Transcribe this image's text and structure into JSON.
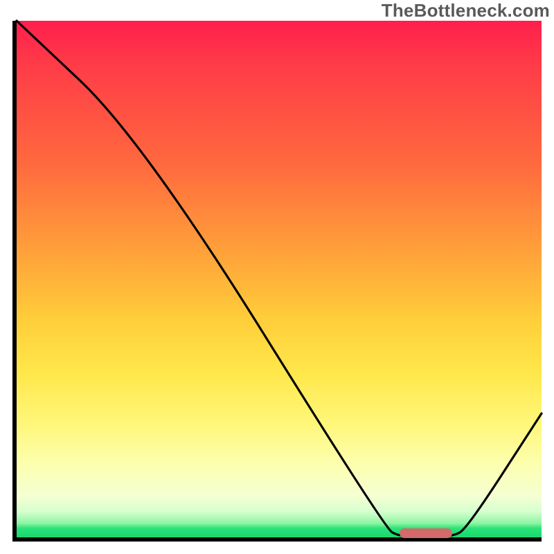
{
  "watermark": {
    "text": "TheBottleneck.com"
  },
  "chart_data": {
    "type": "line",
    "title": "",
    "xlabel": "",
    "ylabel": "",
    "xlim": [
      0,
      100
    ],
    "ylim": [
      0,
      100
    ],
    "grid": false,
    "legend": false,
    "curve_points_pct": [
      {
        "x": 0.0,
        "y": 100.0
      },
      {
        "x": 24.0,
        "y": 77.0
      },
      {
        "x": 70.0,
        "y": 2.0
      },
      {
        "x": 73.0,
        "y": 0.0
      },
      {
        "x": 83.0,
        "y": 0.0
      },
      {
        "x": 86.0,
        "y": 2.0
      },
      {
        "x": 100.0,
        "y": 24.0
      }
    ],
    "marker": {
      "x_start_pct": 73.0,
      "x_end_pct": 83.0,
      "y_pct": 0.8,
      "color": "#d46a6a"
    },
    "background_gradient": {
      "top": "#ff1e4c",
      "mid": "#ffce3a",
      "low": "#fcffb0",
      "bottom": "#18d86e"
    }
  }
}
